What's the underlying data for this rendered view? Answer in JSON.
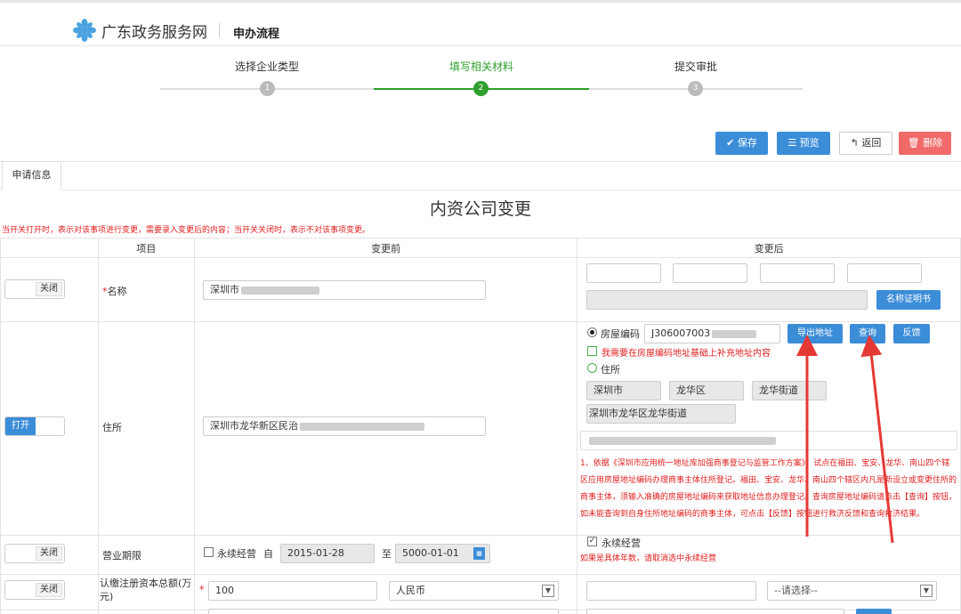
{
  "header": {
    "site_name": "广东政务服务网",
    "flow_title": "申办流程"
  },
  "steps": [
    {
      "label": "选择企业类型",
      "num": "1"
    },
    {
      "label": "填写相关材料",
      "num": "2"
    },
    {
      "label": "提交审批",
      "num": "3"
    }
  ],
  "toolbar": {
    "save": "✔ 保存",
    "preview": "☰ 预览",
    "back": "↰ 返回",
    "delete": "🗑 删除"
  },
  "tab": "申请信息",
  "form_title": "内资公司变更",
  "notice": "当开关打开时，表示对该事项进行变更，需要录入变更后的内容；当开关关闭时，表示不对该事项变更。",
  "columns": {
    "item": "项目",
    "before": "变更前",
    "after": "变更后"
  },
  "toggle": {
    "off": "关闭",
    "on": "打开"
  },
  "rows": {
    "name": {
      "label": "名称",
      "before": "深圳市",
      "cert_button": "名称证明书"
    },
    "address": {
      "label": "住所",
      "before": "深圳市龙华新区民治",
      "house_code_label": "房屋编码",
      "house_code_value": "J306007003",
      "export_button": "导出地址",
      "query_button": "查询",
      "feedback_button": "反馈",
      "supplement_label": "我需要在房屋编码地址基础上补充地址内容",
      "residence_label": "住所",
      "city": "深圳市",
      "district": "龙华区",
      "street": "龙华街道",
      "full": "深圳市龙华区龙华街道",
      "note": "1、依据《深圳市应用统一地址库加强商事登记与监管工作方案》，试点在福田、宝安、龙华、南山四个辖区应用房屋地址编码办理商事主体住所登记。福田、宝安、龙华、南山四个辖区内凡是新设立或变更住所的商事主体，须输入准确的房屋地址编码来获取地址信息办理登记。查询房屋地址编码请点击【查询】按钮，如未能查询到自身住所地址编码的商事主体，可点击【反馈】按钮进行救济反馈和查询救济结果。"
    },
    "term": {
      "label": "营业期限",
      "permanent": "永续经营",
      "from_label": "自",
      "from": "2015-01-28",
      "to_label": "至",
      "to": "5000-01-01",
      "after_permanent": "永续经营",
      "after_note": "如果是具体年数，请取消选中永续经营"
    },
    "capital": {
      "label": "认缴注册资本总额(万元)",
      "amount": "100",
      "currency": "人民币",
      "after_placeholder": "--请选择--"
    }
  }
}
